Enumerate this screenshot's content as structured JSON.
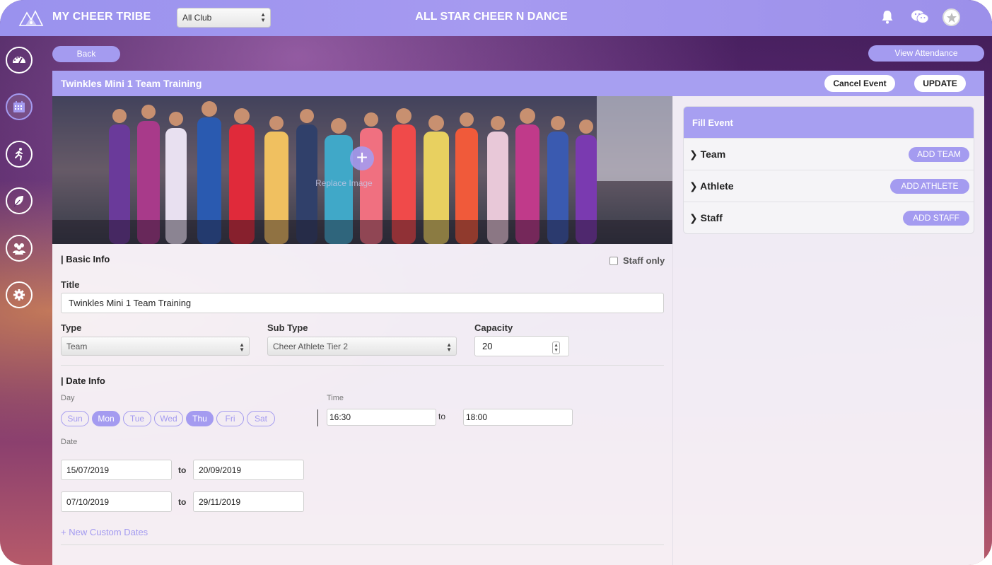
{
  "topbar": {
    "brand": "MY CHEER TRIBE",
    "club_select": "All Club",
    "club_title": "ALL STAR CHEER N DANCE",
    "icons": [
      "bell-icon",
      "chat-icon",
      "star-avatar-icon"
    ]
  },
  "sidebar": {
    "items": [
      {
        "icon": "dashboard-icon"
      },
      {
        "icon": "calendar-icon",
        "active": true
      },
      {
        "icon": "runner-icon"
      },
      {
        "icon": "leaf-icon"
      },
      {
        "icon": "group-icon"
      },
      {
        "icon": "gear-icon"
      }
    ]
  },
  "actions": {
    "back": "Back",
    "view_attendance": "View Attendance"
  },
  "event": {
    "title": "Twinkles Mini 1 Team Training",
    "cancel": "Cancel Event",
    "update": "UPDATE",
    "banner_text": "Replace Image"
  },
  "basic_info": {
    "section": "| Basic Info",
    "staff_only": "Staff only",
    "title_label": "Title",
    "title_value": "Twinkles Mini 1 Team Training",
    "type_label": "Type",
    "type_value": "Team",
    "subtype_label": "Sub Type",
    "subtype_value": "Cheer Athlete Tier 2",
    "capacity_label": "Capacity",
    "capacity_value": "20"
  },
  "date_info": {
    "section": "| Date Info",
    "day_label": "Day",
    "days": [
      {
        "label": "Sun",
        "selected": false
      },
      {
        "label": "Mon",
        "selected": true
      },
      {
        "label": "Tue",
        "selected": false
      },
      {
        "label": "Wed",
        "selected": false
      },
      {
        "label": "Thu",
        "selected": true
      },
      {
        "label": "Fri",
        "selected": false
      },
      {
        "label": "Sat",
        "selected": false
      }
    ],
    "time_label": "Time",
    "time_from": "16:30",
    "time_to": "18:00",
    "to": "to",
    "date_label": "Date",
    "ranges": [
      {
        "from": "15/07/2019",
        "to": "20/09/2019"
      },
      {
        "from": "07/10/2019",
        "to": "29/11/2019"
      }
    ],
    "custom_dates": "+ New Custom Dates"
  },
  "fill_event": {
    "title": "Fill Event",
    "rows": [
      {
        "label": "Team",
        "button": "ADD TEAM"
      },
      {
        "label": "Athlete",
        "button": "ADD ATHLETE"
      },
      {
        "label": "Staff",
        "button": "ADD STAFF"
      }
    ]
  },
  "colors": {
    "accent": "#a49bf0",
    "header": "#a79ff1"
  }
}
